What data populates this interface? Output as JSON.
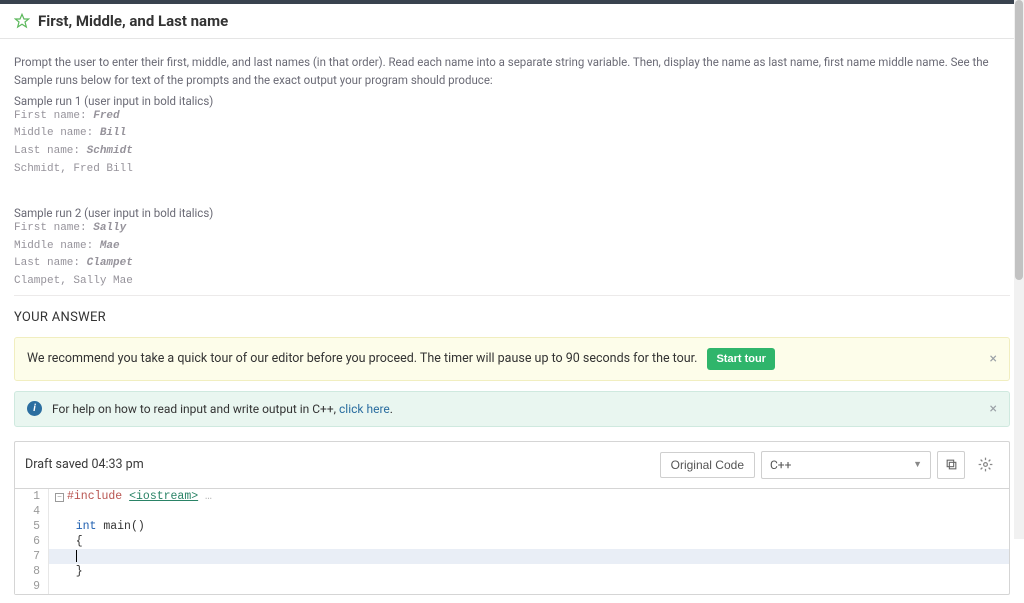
{
  "header": {
    "title": "First, Middle, and Last name"
  },
  "problem": {
    "instructions": "Prompt the user to enter their first, middle, and last names (in that order). Read each name into a separate string variable. Then, display the name as last name, first name middle name. See the Sample runs below for text of the prompts and the exact output your program should produce:",
    "sample1_label": "Sample run 1 (user input in bold italics)",
    "sample1": {
      "p1": "First name: ",
      "i1": "Fred",
      "p2": "Middle name: ",
      "i2": "Bill",
      "p3": "Last name: ",
      "i3": "Schmidt",
      "out": "Schmidt, Fred Bill"
    },
    "sample2_label": "Sample run 2 (user input in bold italics)",
    "sample2": {
      "p1": "First name: ",
      "i1": "Sally",
      "p2": "Middle name: ",
      "i2": "Mae",
      "p3": "Last name: ",
      "i3": "Clampet",
      "out": "Clampet, Sally Mae"
    }
  },
  "answer": {
    "heading": "YOUR ANSWER"
  },
  "tour": {
    "text": "We recommend you take a quick tour of our editor before you proceed. The timer will pause up to 90 seconds for the tour.",
    "button": "Start tour"
  },
  "help": {
    "prefix": "For help on how to read input and write output in C++, ",
    "link": "click here",
    "suffix": "."
  },
  "editor": {
    "draft": "Draft saved 04:33 pm",
    "original_btn": "Original Code",
    "language": "C++",
    "lines": {
      "n1": "1",
      "n4": "4",
      "n5": "5",
      "n6": "6",
      "n7": "7",
      "n8": "8",
      "n9": "9"
    },
    "code": {
      "l1_pre": "#include ",
      "l1_inc": "<iostream>",
      "l1_dots": " …",
      "l5": "int main()",
      "l5_kw": "int",
      "l5_rest": " main()",
      "l6": "{",
      "l8": "}"
    }
  }
}
